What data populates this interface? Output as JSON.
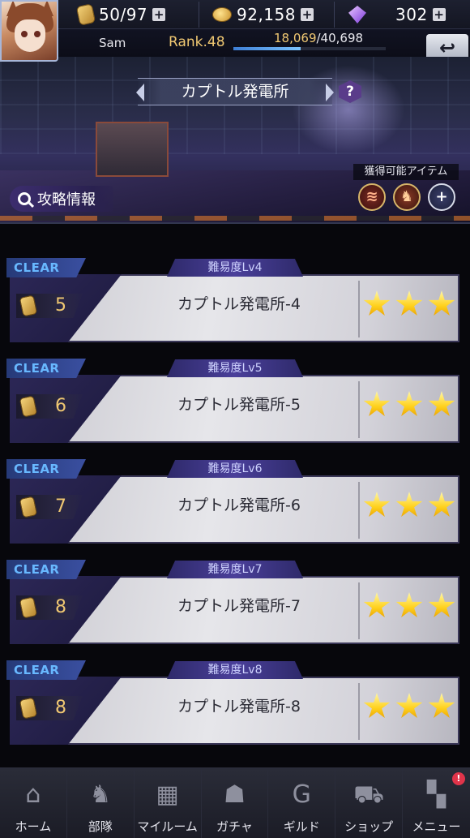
{
  "resources": {
    "stamina": "50/97",
    "gold": "92,158",
    "gems": "302",
    "add_label": "+",
    "icons": {
      "stamina": "stamina-can-icon",
      "gold": "gold-coin-icon",
      "gems": "gem-icon"
    }
  },
  "player": {
    "name": "Sam",
    "rank": "Rank.48",
    "exp_current": "18,069",
    "exp_max": "/40,698",
    "exp_progress": 0.444
  },
  "header": {
    "back_icon": "↩",
    "stage_area_title": "カプトル発電所",
    "help_label": "?",
    "guide_button": "攻略情報",
    "items_label": "獲得可能アイテム",
    "item_icons": [
      "slash-item-icon",
      "beast-emblem-icon",
      "plus-icon"
    ],
    "item_glyphs": [
      "≋",
      "♞",
      "+"
    ]
  },
  "stages": [
    {
      "status": "CLEAR",
      "difficulty": "難易度Lv4",
      "cost": "5",
      "name": "カプトル発電所-4",
      "stars": 3
    },
    {
      "status": "CLEAR",
      "difficulty": "難易度Lv5",
      "cost": "6",
      "name": "カプトル発電所-5",
      "stars": 3
    },
    {
      "status": "CLEAR",
      "difficulty": "難易度Lv6",
      "cost": "7",
      "name": "カプトル発電所-6",
      "stars": 3
    },
    {
      "status": "CLEAR",
      "difficulty": "難易度Lv7",
      "cost": "8",
      "name": "カプトル発電所-7",
      "stars": 3
    },
    {
      "status": "CLEAR",
      "difficulty": "難易度Lv8",
      "cost": "8",
      "name": "カプトル発電所-8",
      "stars": 3
    }
  ],
  "nav": {
    "items": [
      {
        "label": "ホーム",
        "icon": "home-icon",
        "glyph": "⌂"
      },
      {
        "label": "部隊",
        "icon": "squad-icon",
        "glyph": "♞"
      },
      {
        "label": "マイルーム",
        "icon": "my-room-icon",
        "glyph": "▦"
      },
      {
        "label": "ガチャ",
        "icon": "gacha-icon",
        "glyph": "☗"
      },
      {
        "label": "ギルド",
        "icon": "guild-icon",
        "glyph": "G"
      },
      {
        "label": "ショップ",
        "icon": "shop-cart-icon",
        "glyph": "⛟"
      },
      {
        "label": "メニュー",
        "icon": "menu-grid-icon",
        "glyph": "▚"
      }
    ],
    "menu_badge": "!"
  },
  "colors": {
    "clear_text": "#68b8ff",
    "cost_text": "#f0c872",
    "star": "#ffd21e",
    "rank_text": "#f0c872"
  }
}
